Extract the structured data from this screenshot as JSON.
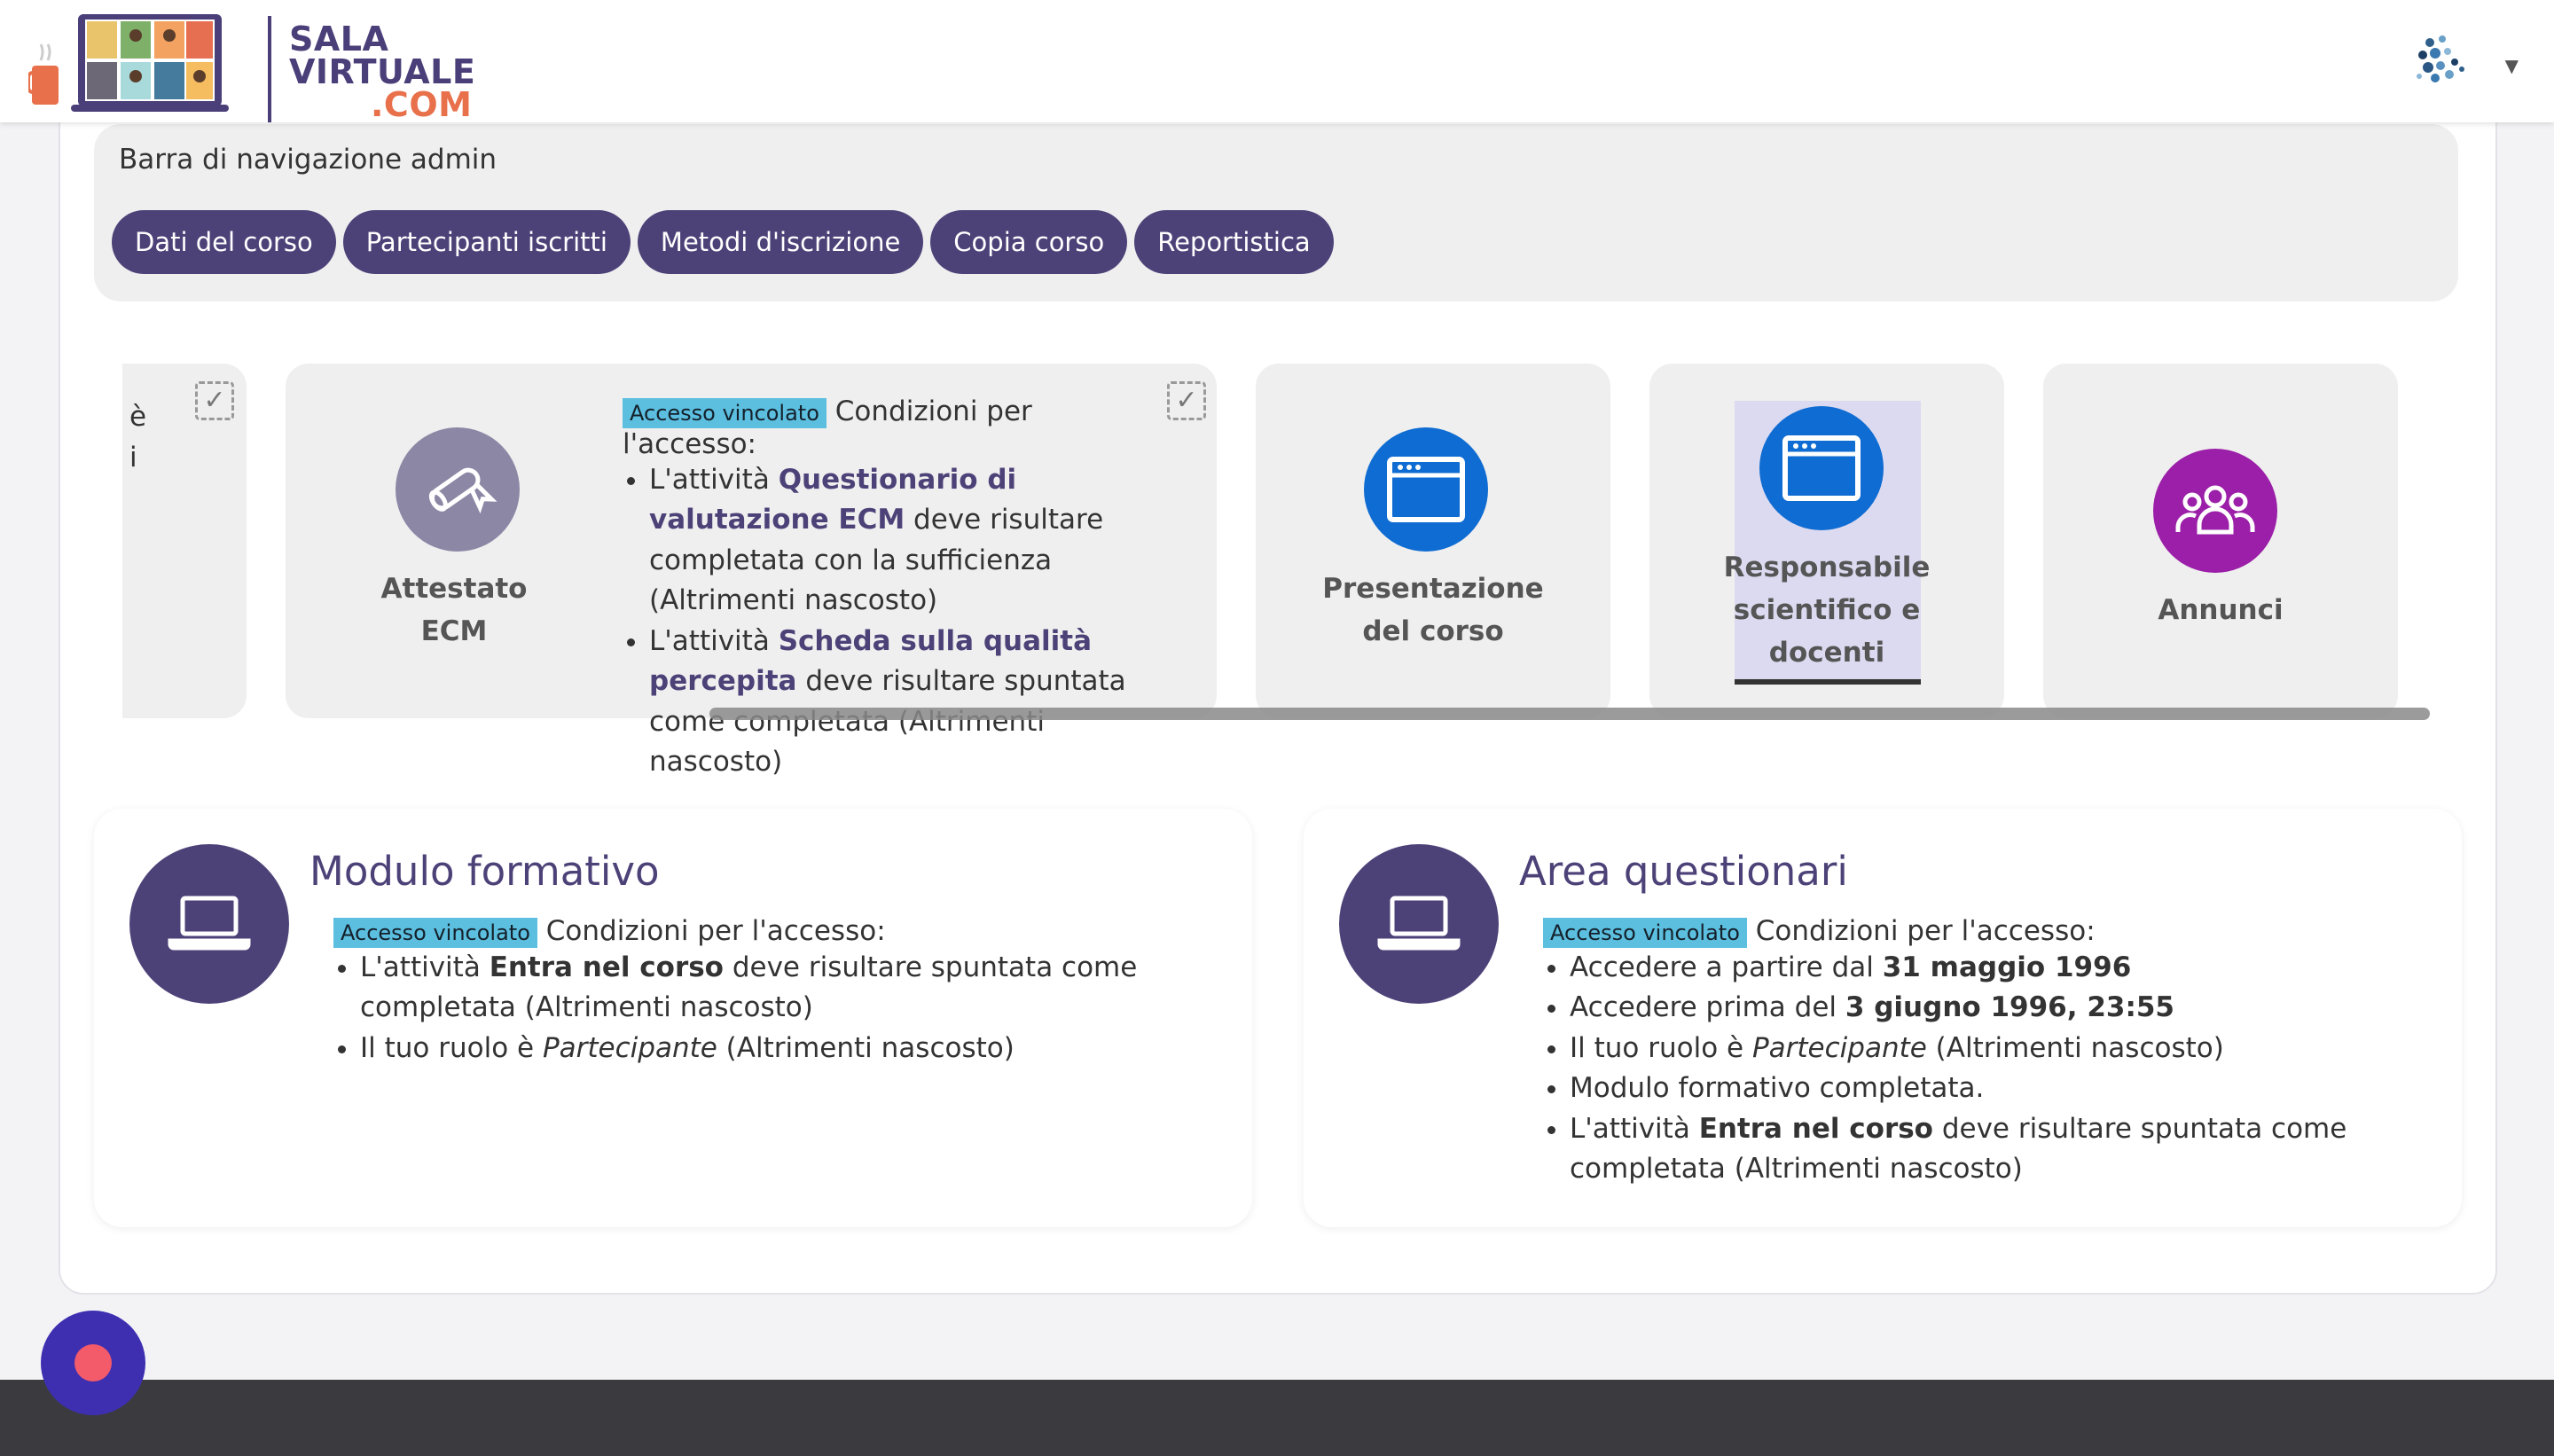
{
  "brand": {
    "line1": "SALA",
    "line2": "VIRTUALE",
    "line3": ".COM",
    "accent_color": "#4d4278",
    "secondary_color": "#e8704a"
  },
  "user_menu": {
    "avatar_icon": "user-avatar-dots-icon",
    "caret_icon": "caret-down-icon"
  },
  "admin_nav": {
    "title": "Barra di navigazione admin",
    "buttons": [
      "Dati del corso",
      "Partecipanti iscritti",
      "Metodi d'iscrizione",
      "Copia corso",
      "Reportistica"
    ]
  },
  "carousel": {
    "partial_tile": {
      "line1": "è",
      "line2": "i"
    },
    "attestato": {
      "title_line1": "Attestato",
      "title_line2": "ECM",
      "icon": "certificate-icon",
      "badge": "Accesso vincolato",
      "conditions_head": "Condizioni per l'accesso:",
      "c1_pre": "L'attività ",
      "c1_bold": "Questionario di valutazione ECM",
      "c1_post": " deve risultare completata con la sufficienza (Altrimenti nascosto)",
      "c2_pre": "L'attività ",
      "c2_bold": "Scheda sulla qualità percepita",
      "c2_post": " deve risultare spuntata come completata (Altrimenti nascosto)"
    },
    "presentazione": {
      "title_line1": "Presentazione",
      "title_line2": "del corso",
      "icon": "browser-window-icon"
    },
    "responsabile": {
      "title_line1": "Responsabile",
      "title_line2": "scientifico e",
      "title_line3": "docenti",
      "icon": "browser-window-icon"
    },
    "annunci": {
      "title": "Annunci",
      "icon": "users-group-icon"
    }
  },
  "sections": {
    "modulo": {
      "title": "Modulo formativo",
      "badge": "Accesso vincolato",
      "conditions_head": "Condizioni per l'accesso:",
      "c1_pre": "L'attività ",
      "c1_bold": "Entra nel corso",
      "c1_post": " deve risultare spuntata come completata (Altrimenti nascosto)",
      "c2_pre": "Il tuo ruolo è ",
      "c2_italic": "Partecipante",
      "c2_post": " (Altrimenti nascosto)"
    },
    "area": {
      "title": "Area questionari",
      "badge": "Accesso vincolato",
      "conditions_head": "Condizioni per l'accesso:",
      "c1_pre": "Accedere a partire dal ",
      "c1_bold": "31 maggio 1996",
      "c2_pre": "Accedere prima del ",
      "c2_bold": "3 giugno 1996, 23:55",
      "c3_pre": "Il tuo ruolo è ",
      "c3_italic": "Partecipante",
      "c3_post": " (Altrimenti nascosto)",
      "c4": "Modulo formativo completata.",
      "c5_pre": "L'attività ",
      "c5_bold": "Entra nel corso",
      "c5_post": " deve risultare spuntata come completata (Altrimenti nascosto)"
    }
  }
}
